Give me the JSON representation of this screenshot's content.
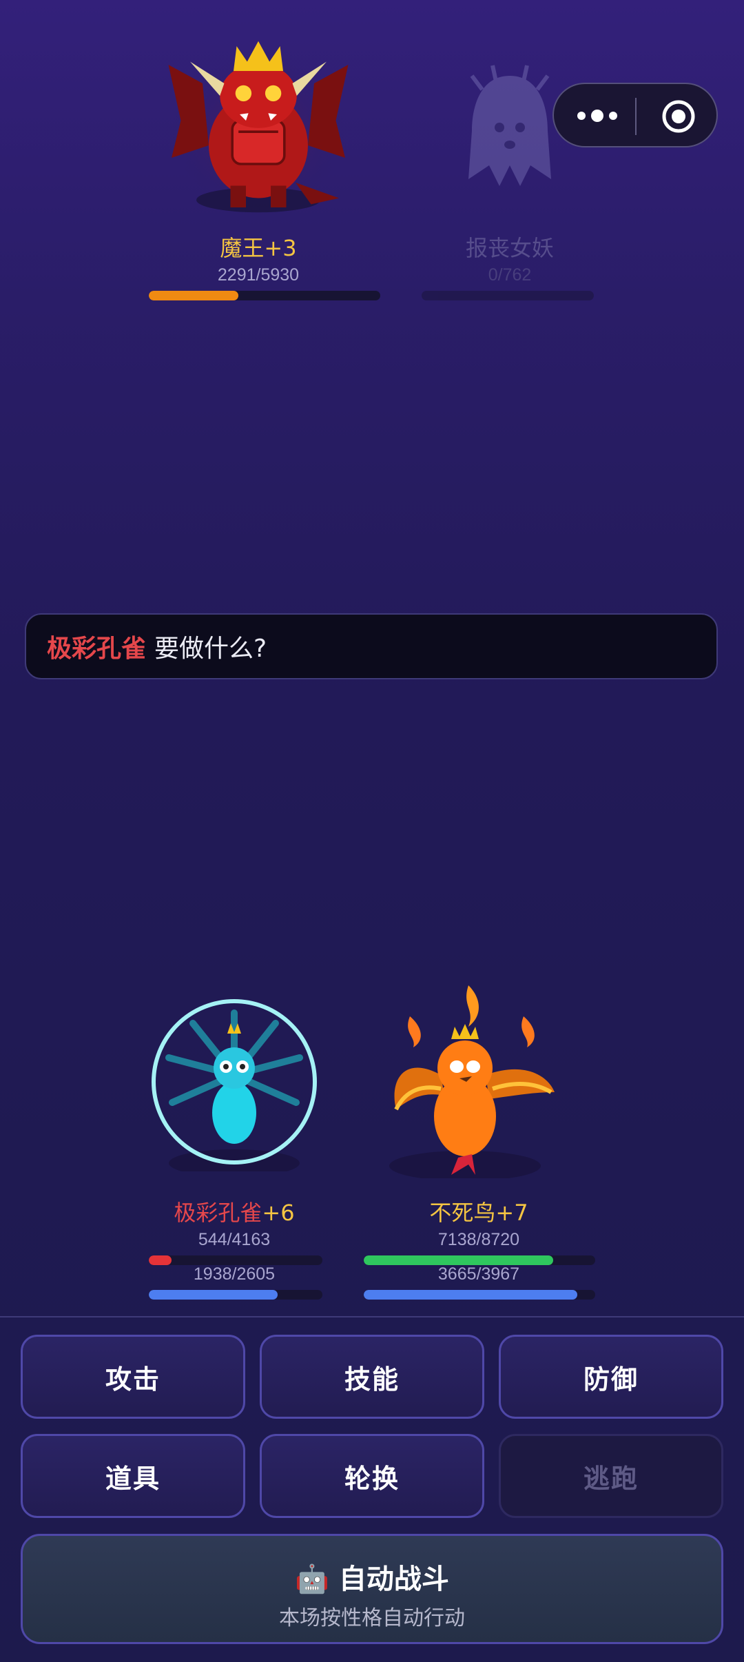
{
  "enemies": [
    {
      "name": "魔王",
      "level": "+3",
      "hp_text": "2291/5930",
      "hp_fraction": 0.386,
      "bar_color": "#f08a12"
    },
    {
      "name": "报丧女妖",
      "level": "",
      "hp_text": "0/762",
      "hp_fraction": 0.0,
      "bar_color": "#6b6a8a"
    }
  ],
  "prompt": {
    "actor": "极彩孔雀",
    "question": "要做什么?"
  },
  "allies": [
    {
      "name": "极彩孔雀",
      "level": "+6",
      "hp_text": "544/4163",
      "hp_fraction": 0.131,
      "hp_color": "#e53338",
      "mp_text": "1938/2605",
      "mp_fraction": 0.744,
      "mp_color": "#4d7ef0",
      "selected": true
    },
    {
      "name": "不死鸟",
      "level": "+7",
      "hp_text": "7138/8720",
      "hp_fraction": 0.819,
      "hp_color": "#2fc75e",
      "mp_text": "3665/3967",
      "mp_fraction": 0.924,
      "mp_color": "#4d7ef0",
      "selected": false
    }
  ],
  "actions": {
    "attack": "攻击",
    "skill": "技能",
    "defend": "防御",
    "item": "道具",
    "switch": "轮换",
    "flee": "逃跑"
  },
  "auto_battle": {
    "icon": "🤖",
    "label": "自动战斗",
    "subtitle": "本场按性格自动行动"
  },
  "icons": {
    "more": "more-dots-icon",
    "target": "target-icon"
  },
  "colors": {
    "enemy_name": "#f5c542",
    "ally_selected_name": "#e5474b",
    "ally_name": "#f5c542",
    "level": "#f5c542"
  }
}
